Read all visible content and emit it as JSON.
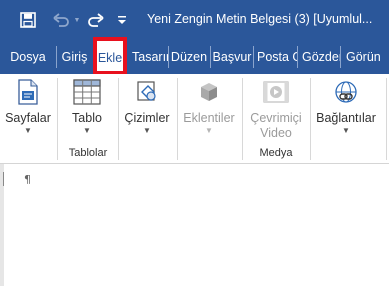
{
  "title_bar": {
    "title": "Yeni Zengin Metin Belgesi (3) [Uyumlul..."
  },
  "tabs": [
    {
      "label": "Dosya",
      "active": false
    },
    {
      "label": "Giriş",
      "active": false
    },
    {
      "label": "Ekle",
      "active": true
    },
    {
      "label": "Tasarım",
      "active": false
    },
    {
      "label": "Düzen",
      "active": false
    },
    {
      "label": "Başvur",
      "active": false
    },
    {
      "label": "Posta G",
      "active": false
    },
    {
      "label": "Gözden",
      "active": false
    },
    {
      "label": "Görün",
      "active": false
    }
  ],
  "ribbon": {
    "buttons": [
      {
        "label": "Sayfalar",
        "icon": "pages-icon",
        "enabled": true
      },
      {
        "label": "Tablo",
        "icon": "table-icon",
        "enabled": true
      },
      {
        "label": "Çizimler",
        "icon": "shapes-icon",
        "enabled": true
      },
      {
        "label": "Eklentiler",
        "icon": "addins-icon",
        "enabled": false
      },
      {
        "label": "Çevrimiçi",
        "label2": "Video",
        "icon": "online-video-icon",
        "enabled": false
      },
      {
        "label": "Bağlantılar",
        "icon": "links-icon",
        "enabled": true
      }
    ],
    "groups": [
      {
        "label": "Tablolar"
      },
      {
        "label": "Medya"
      }
    ]
  },
  "document": {
    "paragraph_mark": "¶"
  },
  "colors": {
    "accent": "#2b579a",
    "highlight": "#e8101e",
    "disabled_text": "#9b9b9b"
  }
}
